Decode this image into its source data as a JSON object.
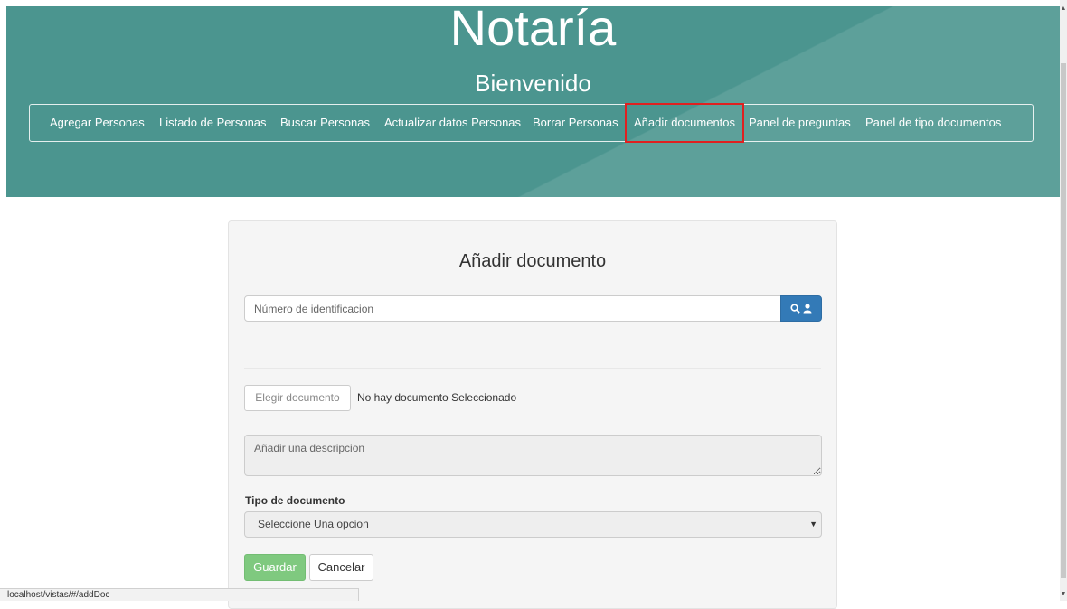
{
  "header": {
    "site_title": "Notaría",
    "welcome": "Bienvenido"
  },
  "nav": {
    "items": [
      {
        "label": "Agregar Personas"
      },
      {
        "label": "Listado de Personas"
      },
      {
        "label": "Buscar Personas"
      },
      {
        "label": "Actualizar datos Personas"
      },
      {
        "label": "Borrar Personas"
      },
      {
        "label": "Añadir documentos",
        "active": true
      },
      {
        "label": "Panel de preguntas"
      },
      {
        "label": "Panel de tipo documentos"
      }
    ]
  },
  "form": {
    "title": "Añadir documento",
    "id_placeholder": "Número de identificacion",
    "search_icon": "search-icon",
    "user_icon": "user-icon",
    "choose_button": "Elegir documento",
    "file_status": "No hay documento Seleccionado",
    "description_placeholder": "Añadir una descripcion",
    "type_label": "Tipo de documento",
    "type_selected": "Seleccione Una opcion",
    "save_button": "Guardar",
    "cancel_button": "Cancelar"
  },
  "status_bar": {
    "url": "localhost/vistas/#/addDoc"
  },
  "colors": {
    "header_bg": "#4b958f",
    "primary": "#337ab7",
    "success": "#7fc97f",
    "active_outline": "#e02020"
  }
}
